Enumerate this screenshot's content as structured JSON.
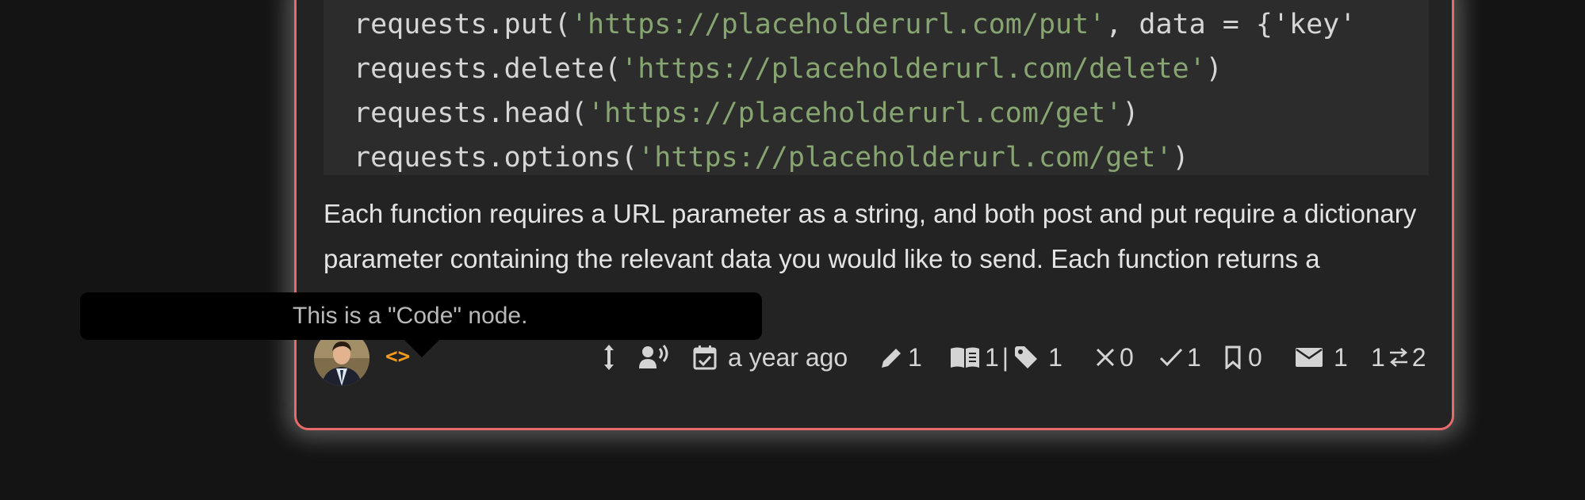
{
  "code": {
    "lines": [
      {
        "prefix": "requests.put(",
        "string": "'https://placeholderurl.com/put'",
        "suffix": ", data = {'key'"
      },
      {
        "prefix": "requests.delete(",
        "string": "'https://placeholderurl.com/delete'",
        "suffix": ")"
      },
      {
        "prefix": "requests.head(",
        "string": "'https://placeholderurl.com/get'",
        "suffix": ")"
      },
      {
        "prefix": "requests.options(",
        "string": "'https://placeholderurl.com/get'",
        "suffix": ")"
      }
    ]
  },
  "paragraph": {
    "text": "Each function requires a URL parameter as a string, and both post and put require a dictionary parameter containing the relevant data you would like to send. Each function returns a Response object."
  },
  "tooltip": {
    "text": "This is a \"Code\" node."
  },
  "footer": {
    "toggle_label": "<>",
    "timestamp": "a year ago",
    "edits": "1",
    "sources": "1",
    "separator": "|",
    "tags": "1",
    "rejected": "0",
    "accepted": "1",
    "bookmarks": "0",
    "messages": "1",
    "links_left": "1",
    "links_right": "2"
  },
  "colors": {
    "card_border": "#e96a6a",
    "accent": "#f49b1e",
    "string": "#87a570"
  }
}
